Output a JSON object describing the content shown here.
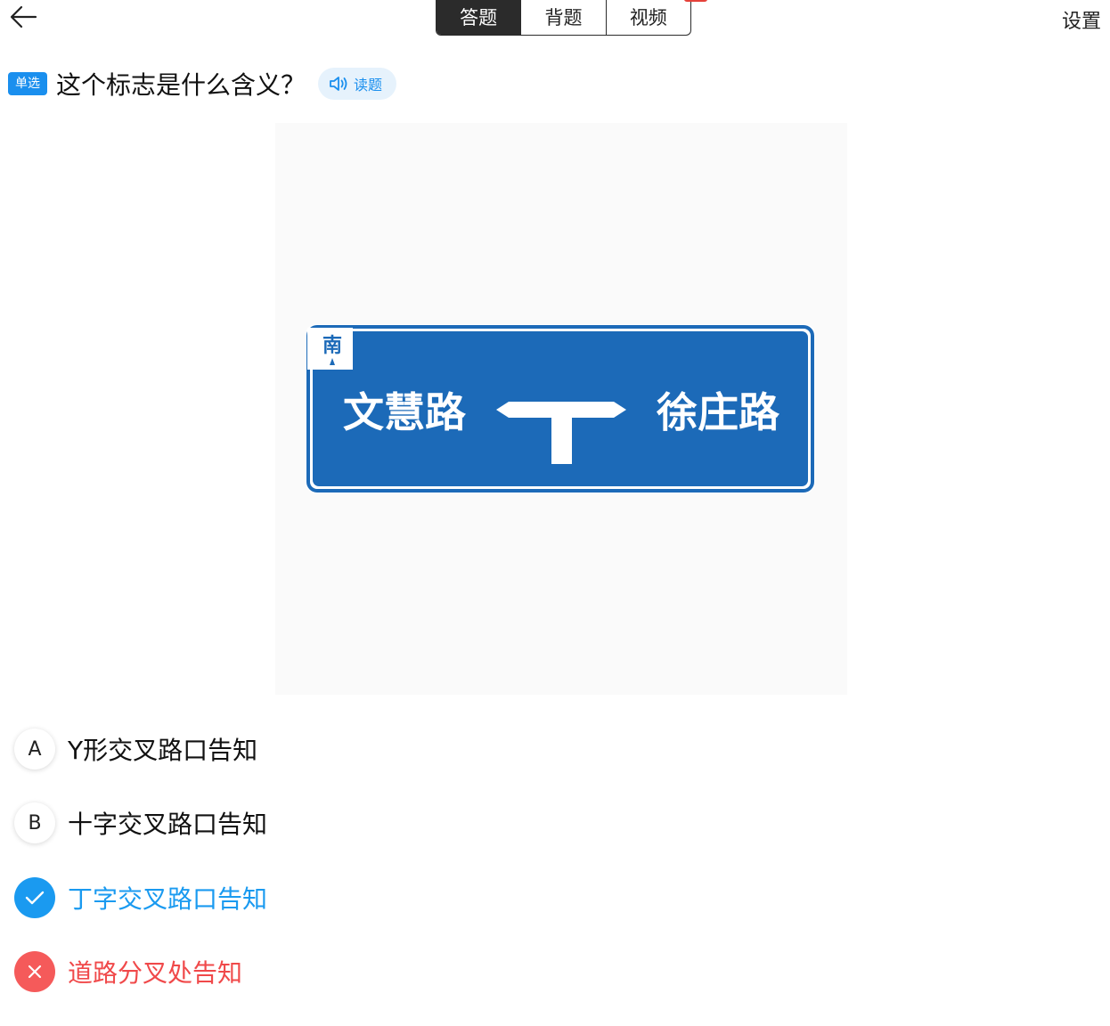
{
  "header": {
    "tabs": [
      {
        "label": "答题",
        "active": true
      },
      {
        "label": "背题",
        "active": false
      },
      {
        "label": "视频",
        "active": false
      }
    ],
    "settings_label": "设置"
  },
  "question": {
    "type_badge": "单选",
    "text": "这个标志是什么含义？",
    "read_label": "读题"
  },
  "sign": {
    "direction": "南",
    "left_road": "文慧路",
    "right_road": "徐庄路",
    "color": "#1c6ab8"
  },
  "options": [
    {
      "letter": "A",
      "text": "Y形交叉路口告知",
      "state": "normal"
    },
    {
      "letter": "B",
      "text": "十字交叉路口告知",
      "state": "normal"
    },
    {
      "letter": "",
      "text": "丁字交叉路口告知",
      "state": "correct"
    },
    {
      "letter": "",
      "text": "道路分叉处告知",
      "state": "wrong"
    }
  ],
  "colors": {
    "accent": "#1a9af0",
    "error": "#f0494a",
    "tab_active": "#2b2b2b"
  }
}
